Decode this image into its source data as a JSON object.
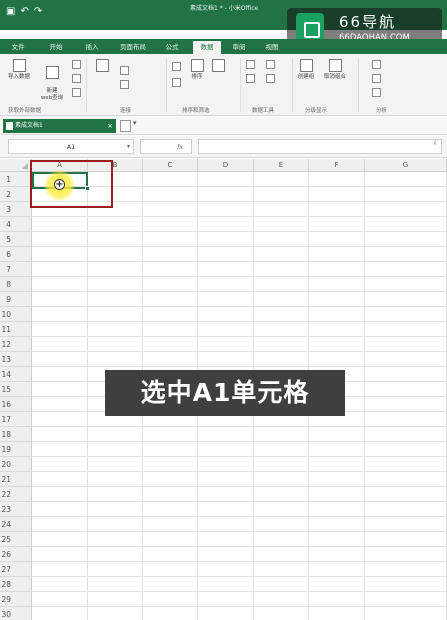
{
  "window": {
    "document_title": "素成文档1 * - 小米Office",
    "quick_access_icons": [
      "save-icon",
      "undo-icon",
      "redo-icon"
    ]
  },
  "ribbon": {
    "tabs": [
      {
        "label": "文件"
      },
      {
        "label": "开始"
      },
      {
        "label": "插入"
      },
      {
        "label": "页面布局"
      },
      {
        "label": "公式"
      },
      {
        "label": "数据",
        "active": true
      },
      {
        "label": "审阅"
      },
      {
        "label": "视图"
      }
    ],
    "buttons": {
      "import_data": "导入数据",
      "new_web_query": "新建\nweb查询",
      "sort": "排序",
      "create_group": "创建组",
      "ungroup": "取消组合"
    },
    "groups": {
      "get_external": "获取外部数据",
      "connections": "连接",
      "sort_filter": "排序和筛选",
      "data_tools": "数据工具",
      "outline": "分级显示",
      "analysis": "分析"
    }
  },
  "workbook": {
    "tab_label": "素成文档1",
    "close": "×",
    "new_tab_dropdown": "▾"
  },
  "formula_bar": {
    "name_box": "A1",
    "fx_label": "fx",
    "formula": ""
  },
  "sheet": {
    "columns": [
      "A",
      "B",
      "C",
      "D",
      "E",
      "F",
      "G"
    ],
    "rows": [
      "1",
      "2",
      "3",
      "4",
      "5",
      "6",
      "7",
      "8",
      "9",
      "10",
      "11",
      "12",
      "13",
      "14",
      "15",
      "16",
      "17",
      "18",
      "19",
      "20",
      "21",
      "22",
      "23",
      "24",
      "25",
      "26",
      "27",
      "28",
      "29",
      "30"
    ],
    "selected_cell": "A1"
  },
  "overlay": {
    "caption": "选中A1单元格"
  },
  "watermark": {
    "title": "66导航",
    "url": "66DAOHAN.COM"
  },
  "colors": {
    "accent": "#217346",
    "highlight_border": "#9c1c1c",
    "caption_bg": "#3f3f3f"
  }
}
